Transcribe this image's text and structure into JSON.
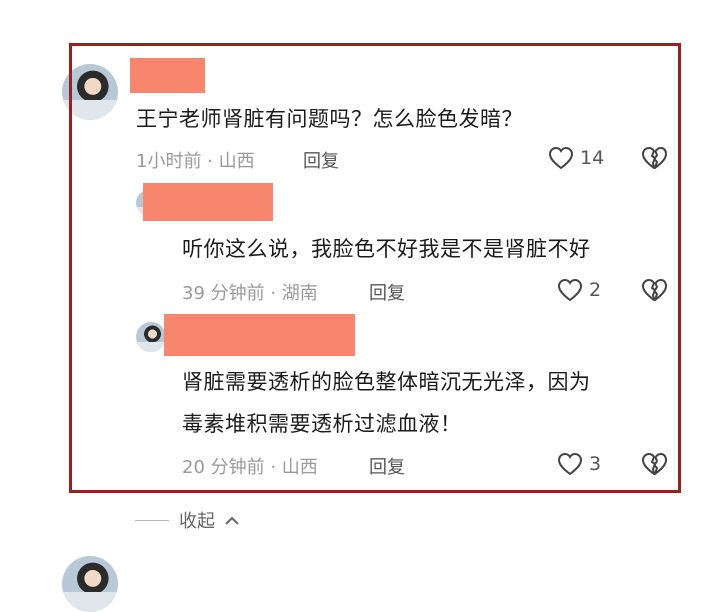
{
  "comments": [
    {
      "text": "王宁老师肾脏有问题吗？怎么脸色发暗？",
      "time_location": "1小时前 · 山西",
      "reply_label": "回复",
      "likes": "14"
    },
    {
      "text": "听你这么说，我脸色不好我是不是肾脏不好",
      "time_location": "39 分钟前 · 湖南",
      "reply_label": "回复",
      "likes": "2"
    },
    {
      "text_line1": "肾脏需要透析的脸色整体暗沉无光泽，因为",
      "text_line2": "毒素堆积需要透析过滤血液！",
      "time_location": "20 分钟前 · 山西",
      "reply_label": "回复",
      "likes": "3"
    }
  ],
  "collapse_label": "收起",
  "icons": {
    "like": "heart-icon",
    "dislike": "broken-heart-icon",
    "collapse": "chevron-up-icon"
  },
  "colors": {
    "frame": "#9b1f1f",
    "redaction": "#f8866c",
    "meta": "#9a9a9a"
  }
}
